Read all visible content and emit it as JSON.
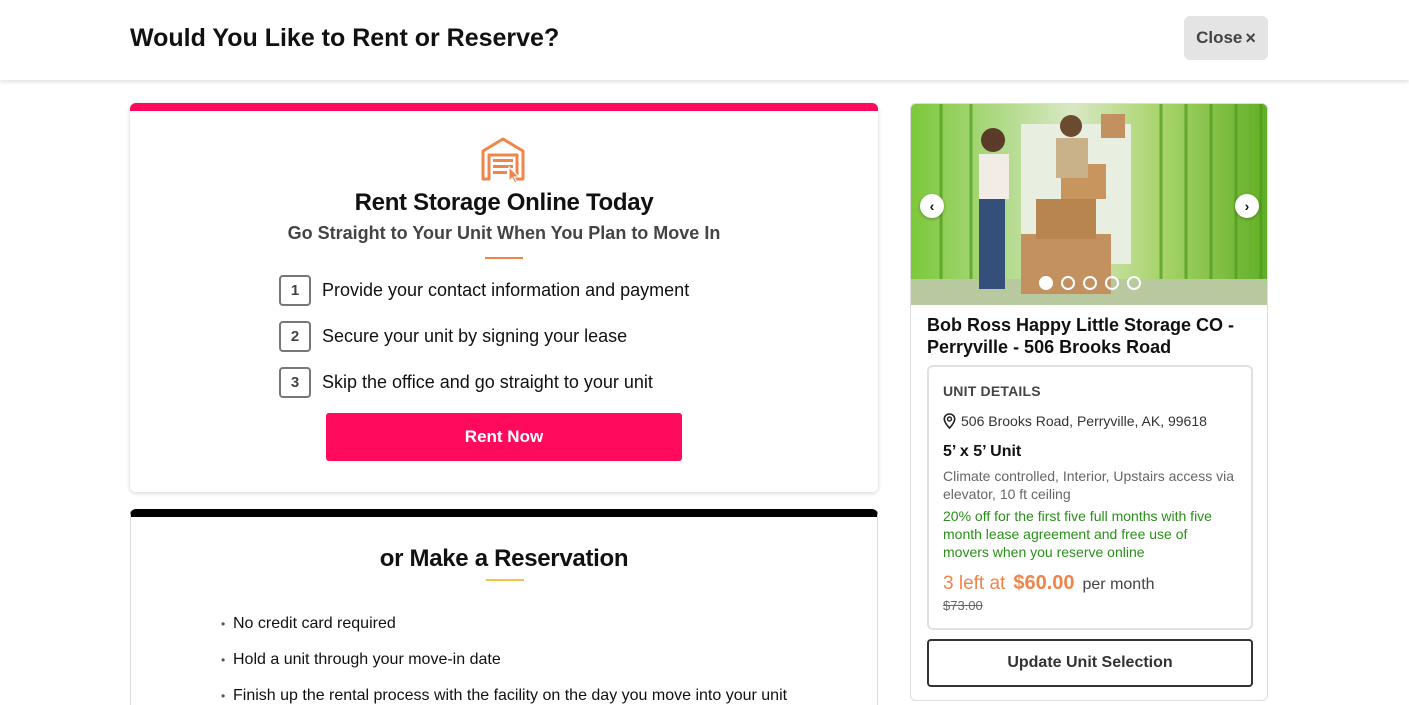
{
  "header": {
    "title": "Would You Like to Rent or Reserve?",
    "close_label": "Close",
    "close_icon": "×"
  },
  "rent": {
    "icon": "storage-unit-click-icon",
    "title": "Rent Storage Online Today",
    "subtitle": "Go Straight to Your Unit When You Plan to Move In",
    "steps": [
      {
        "num": "1",
        "text": "Provide your contact information and payment"
      },
      {
        "num": "2",
        "text": "Secure your unit by signing your lease"
      },
      {
        "num": "3",
        "text": "Skip the office and go straight to your unit"
      }
    ],
    "button_label": "Rent Now",
    "accent_color": "#ff0a5c"
  },
  "reserve": {
    "title": "or Make a Reservation",
    "bullets": [
      "No credit card required",
      "Hold a unit through your move-in date",
      "Finish up the rental process with the facility on the day you move into your unit"
    ]
  },
  "facility": {
    "carousel": {
      "prev": "‹",
      "next": "›",
      "slide_count": 5,
      "active_index": 0
    },
    "name": "Bob Ross Happy Little Storage CO - Perryville - 506 Brooks Road",
    "unit_details_label": "UNIT DETAILS",
    "address": "506 Brooks Road, Perryville, AK, 99618",
    "unit_size": "5’ x 5’ Unit",
    "features": "Climate controlled, Interior, Upstairs access via elevator, 10 ft ceiling",
    "promo": "20% off for the first five full months with five month lease agreement and free use of movers when you reserve online",
    "availability": "3 left at",
    "price": "$60.00",
    "price_period": "per month",
    "original_price": "$73.00",
    "update_label": "Update Unit Selection",
    "price_color": "#f0854a",
    "promo_color": "#2a8f1a"
  }
}
